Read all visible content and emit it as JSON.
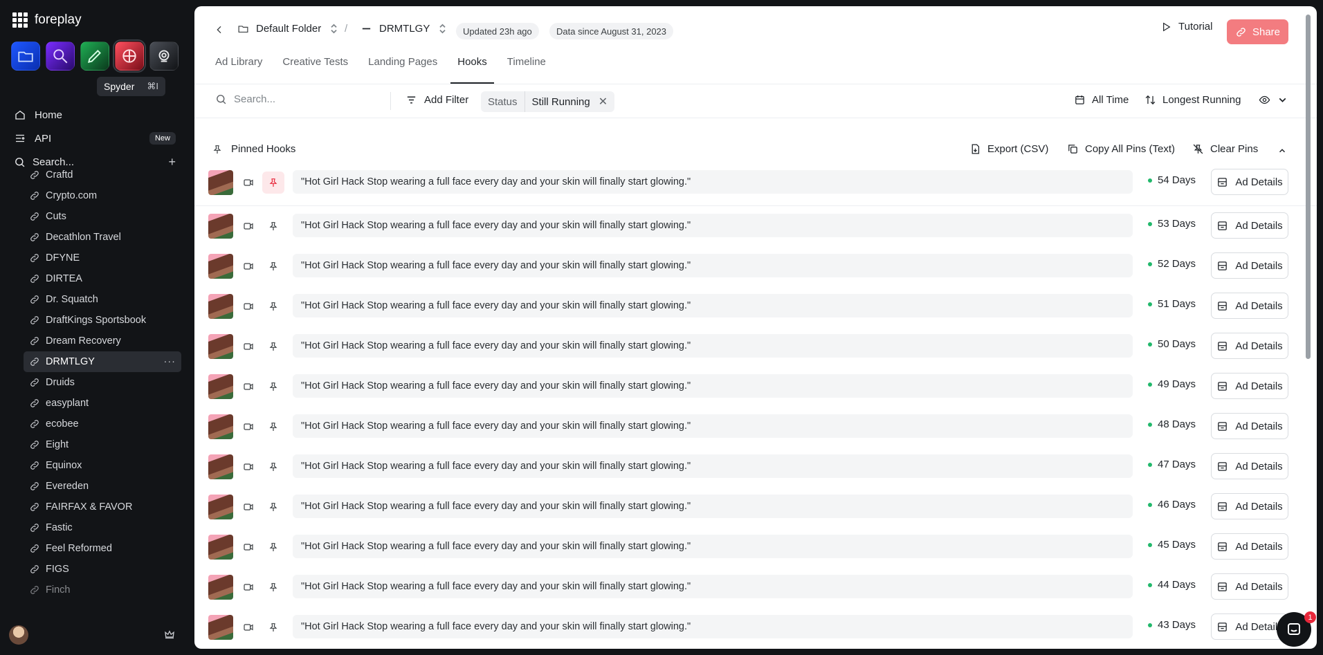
{
  "brand": {
    "name": "foreplay"
  },
  "apps": [
    {
      "name": "app-swipe-file",
      "icon": "folder-icon"
    },
    {
      "name": "app-discovery",
      "icon": "magnifier-icon"
    },
    {
      "name": "app-briefs",
      "icon": "pen-icon"
    },
    {
      "name": "app-spyder",
      "icon": "spyder-icon"
    },
    {
      "name": "app-lens",
      "icon": "lens-icon"
    }
  ],
  "tooltip": {
    "label": "Spyder",
    "shortcut": "⌘I"
  },
  "nav": {
    "home": "Home",
    "api": "API",
    "api_badge": "New",
    "search_placeholder": "Search..."
  },
  "brands": [
    "Craftd",
    "Crypto.com",
    "Cuts",
    "Decathlon Travel",
    "DFYNE",
    "DIRTEA",
    "Dr. Squatch",
    "DraftKings Sportsbook",
    "Dream Recovery",
    "DRMTLGY",
    "Druids",
    "easyplant",
    "ecobee",
    "Eight",
    "Equinox",
    "Evereden",
    "FAIRFAX & FAVOR",
    "Fastic",
    "Feel Reformed",
    "FIGS",
    "Finch"
  ],
  "active_brand": "DRMTLGY",
  "header": {
    "folder": "Default Folder",
    "separator": "/",
    "brand": "DRMTLGY",
    "updated": "Updated 23h ago",
    "data_since": "Data since August 31, 2023",
    "tutorial": "Tutorial",
    "share": "Share"
  },
  "tabs": [
    "Ad Library",
    "Creative Tests",
    "Landing Pages",
    "Hooks",
    "Timeline"
  ],
  "active_tab": "Hooks",
  "filters": {
    "search_placeholder": "Search...",
    "add_filter": "Add Filter",
    "chip_key": "Status",
    "chip_value": "Still Running",
    "date_range": "All Time",
    "sort": "Longest Running"
  },
  "pinned": {
    "title": "Pinned Hooks",
    "export": "Export (CSV)",
    "copy": "Copy All Pins (Text)",
    "clear": "Clear Pins"
  },
  "ad_details_label": "Ad Details",
  "hooks": [
    {
      "text": "\"Hot Girl Hack Stop wearing a full face every day and your skin will finally start glowing.\"",
      "days": "54 Days",
      "pinned": true
    },
    {
      "text": "\"Hot Girl Hack Stop wearing a full face every day and your skin will finally start glowing.\"",
      "days": "53 Days",
      "pinned": false
    },
    {
      "text": "\"Hot Girl Hack Stop wearing a full face every day and your skin will finally start glowing.\"",
      "days": "52 Days",
      "pinned": false
    },
    {
      "text": "\"Hot Girl Hack Stop wearing a full face every day and your skin will finally start glowing.\"",
      "days": "51 Days",
      "pinned": false
    },
    {
      "text": "\"Hot Girl Hack Stop wearing a full face every day and your skin will finally start glowing.\"",
      "days": "50 Days",
      "pinned": false
    },
    {
      "text": "\"Hot Girl Hack Stop wearing a full face every day and your skin will finally start glowing.\"",
      "days": "49 Days",
      "pinned": false
    },
    {
      "text": "\"Hot Girl Hack Stop wearing a full face every day and your skin will finally start glowing.\"",
      "days": "48 Days",
      "pinned": false
    },
    {
      "text": "\"Hot Girl Hack Stop wearing a full face every day and your skin will finally start glowing.\"",
      "days": "47 Days",
      "pinned": false
    },
    {
      "text": "\"Hot Girl Hack Stop wearing a full face every day and your skin will finally start glowing.\"",
      "days": "46 Days",
      "pinned": false
    },
    {
      "text": "\"Hot Girl Hack Stop wearing a full face every day and your skin will finally start glowing.\"",
      "days": "45 Days",
      "pinned": false
    },
    {
      "text": "\"Hot Girl Hack Stop wearing a full face every day and your skin will finally start glowing.\"",
      "days": "44 Days",
      "pinned": false
    },
    {
      "text": "\"Hot Girl Hack Stop wearing a full face every day and your skin will finally start glowing.\"",
      "days": "43 Days",
      "pinned": false
    }
  ],
  "chat": {
    "badge": "1"
  },
  "colors": {
    "accent": "#f37c80",
    "status_dot": "#22b86b",
    "sidebar_bg": "#121417"
  }
}
